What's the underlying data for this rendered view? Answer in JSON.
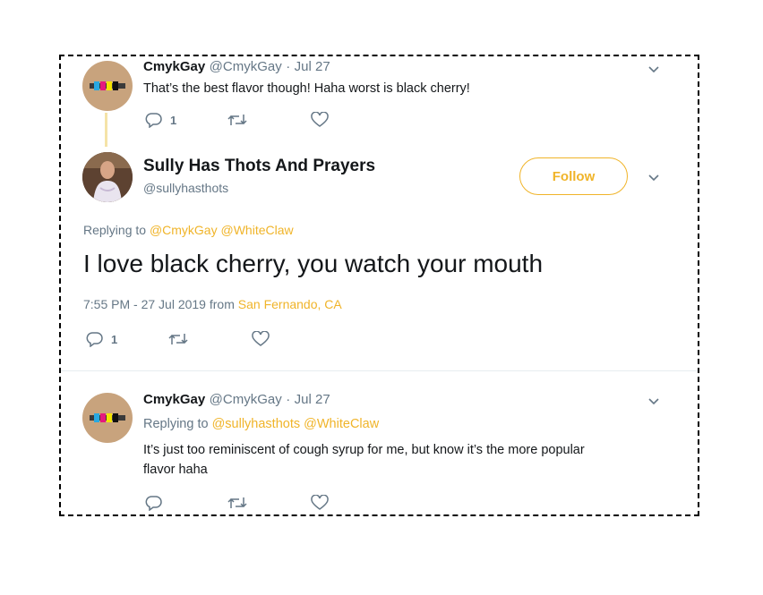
{
  "tweet1": {
    "name": "CmykGay",
    "handle": "@CmykGay",
    "dot": "·",
    "date": "Jul 27",
    "text": "That’s the best flavor though! Haha worst is black cherry!",
    "reply_count": "1"
  },
  "main": {
    "name": "Sully Has Thots And Prayers",
    "handle": "@sullyhasthots",
    "follow_label": "Follow",
    "replying_prefix": "Replying to",
    "reply_to_1": "@CmykGay",
    "reply_to_2": "@WhiteClaw",
    "text": "I love black cherry, you watch your mouth",
    "timestamp": "7:55 PM - 27 Jul 2019 from",
    "location": "San Fernando, CA",
    "reply_count": "1"
  },
  "tweet3": {
    "name": "CmykGay",
    "handle": "@CmykGay",
    "dot": "·",
    "date": "Jul 27",
    "replying_prefix": "Replying to",
    "reply_to_1": "@sullyhasthots",
    "reply_to_2": "@WhiteClaw",
    "text_line1": "It’s just too reminiscent of cough syrup for me, but know it’s the more popular",
    "text_line2": "flavor haha"
  },
  "colors": {
    "accent": "#f0b429",
    "muted": "#657786",
    "text": "#14171a"
  },
  "icons": [
    "reply-icon",
    "retweet-icon",
    "like-icon",
    "chevron-down-icon"
  ]
}
